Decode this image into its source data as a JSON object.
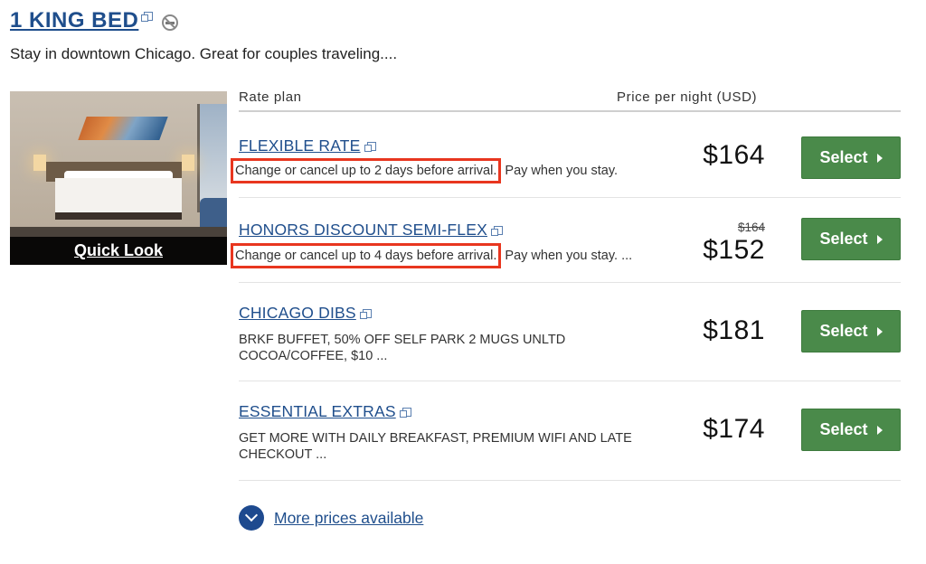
{
  "room": {
    "title": "1 KING BED",
    "description": "Stay in downtown Chicago. Great for couples traveling....",
    "photo_link": "Quick Look"
  },
  "table_header": {
    "rate_plan": "Rate plan",
    "price_per_night": "Price per night (USD)"
  },
  "rates": [
    {
      "name": "FLEXIBLE RATE",
      "highlight": "Change or cancel up to 2 days before arrival.",
      "desc_rest": " Pay when you stay.",
      "original_price": "",
      "price": "$164",
      "button": "Select"
    },
    {
      "name": "HONORS DISCOUNT SEMI-FLEX",
      "highlight": "Change or cancel up to 4 days before arrival.",
      "desc_rest": " Pay when you stay. ...",
      "original_price": "$164",
      "price": "$152",
      "button": "Select"
    },
    {
      "name": "CHICAGO DIBS",
      "desc_line1": "BRKF BUFFET, 50% OFF SELF PARK 2 MUGS UNLTD",
      "desc_line2": "COCOA/COFFEE, $10 ...",
      "price": "$181",
      "button": "Select"
    },
    {
      "name": "ESSENTIAL EXTRAS",
      "desc_line1": "GET MORE WITH DAILY BREAKFAST, PREMIUM WIFI AND LATE",
      "desc_line2": "CHECKOUT ...",
      "price": "$174",
      "button": "Select"
    }
  ],
  "more_prices": "More prices available",
  "colors": {
    "link": "#1f4e8c",
    "select_button": "#4a8a4a",
    "highlight_box": "#e8361f"
  }
}
